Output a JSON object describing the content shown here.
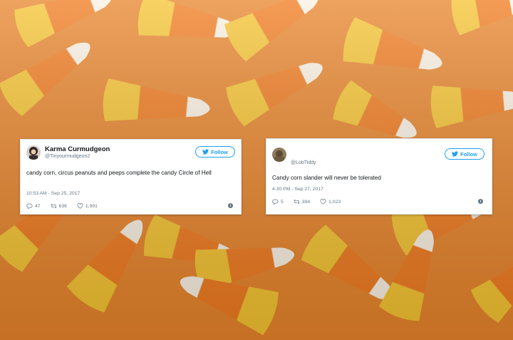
{
  "tweets": [
    {
      "name": "Karma Curmudgeon",
      "handle": "@Tinyourmudgeon2",
      "follow_label": "Follow",
      "text": "candy corn, circus peanuts and peeps complete the candy Circle of Hell",
      "timestamp": "10:53 AM - Sep 25, 2017",
      "replies": "47",
      "retweets": "636",
      "likes": "1,991"
    },
    {
      "name": "",
      "handle": "@LobTiddy",
      "follow_label": "Follow",
      "text": "Candy corn slander will never be tolerated",
      "timestamp": "4:30 PM - Sep 27, 2017",
      "replies": "5",
      "retweets": "394",
      "likes": "1,023"
    }
  ],
  "icons": {
    "reply": "reply-icon",
    "retweet": "retweet-icon",
    "like": "heart-icon",
    "info": "info-icon",
    "bird": "twitter-bird-icon"
  },
  "colors": {
    "twitter_blue": "#1da1f2",
    "secondary_text": "#657786",
    "candy_orange": "#f07a1e",
    "candy_yellow": "#f7c736",
    "candy_white": "#fbf3e6"
  }
}
